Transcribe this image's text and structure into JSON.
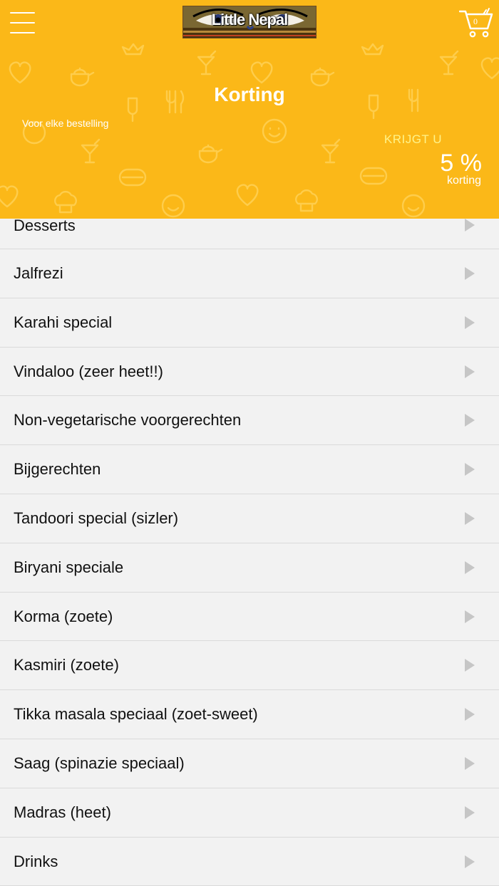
{
  "header": {
    "logo_text": "Little Nepal",
    "cart_count": "0",
    "title": "Korting",
    "subtitle": "Voor elke bestelling",
    "krijgt": "KRIJGT U",
    "discount": "5 %",
    "discount_label": "korting"
  },
  "categories": [
    {
      "label": "Desserts"
    },
    {
      "label": "Jalfrezi"
    },
    {
      "label": "Karahi special"
    },
    {
      "label": "Vindaloo (zeer heet!!)"
    },
    {
      "label": "Non-vegetarische voorgerechten"
    },
    {
      "label": "Bijgerechten"
    },
    {
      "label": "Tandoori special (sizler)"
    },
    {
      "label": "Biryani speciale"
    },
    {
      "label": "Korma (zoete)"
    },
    {
      "label": "Kasmiri (zoete)"
    },
    {
      "label": "Tikka masala speciaal (zoet-sweet)"
    },
    {
      "label": "Saag (spinazie speciaal)"
    },
    {
      "label": "Madras (heet)"
    },
    {
      "label": "Drinks"
    }
  ]
}
